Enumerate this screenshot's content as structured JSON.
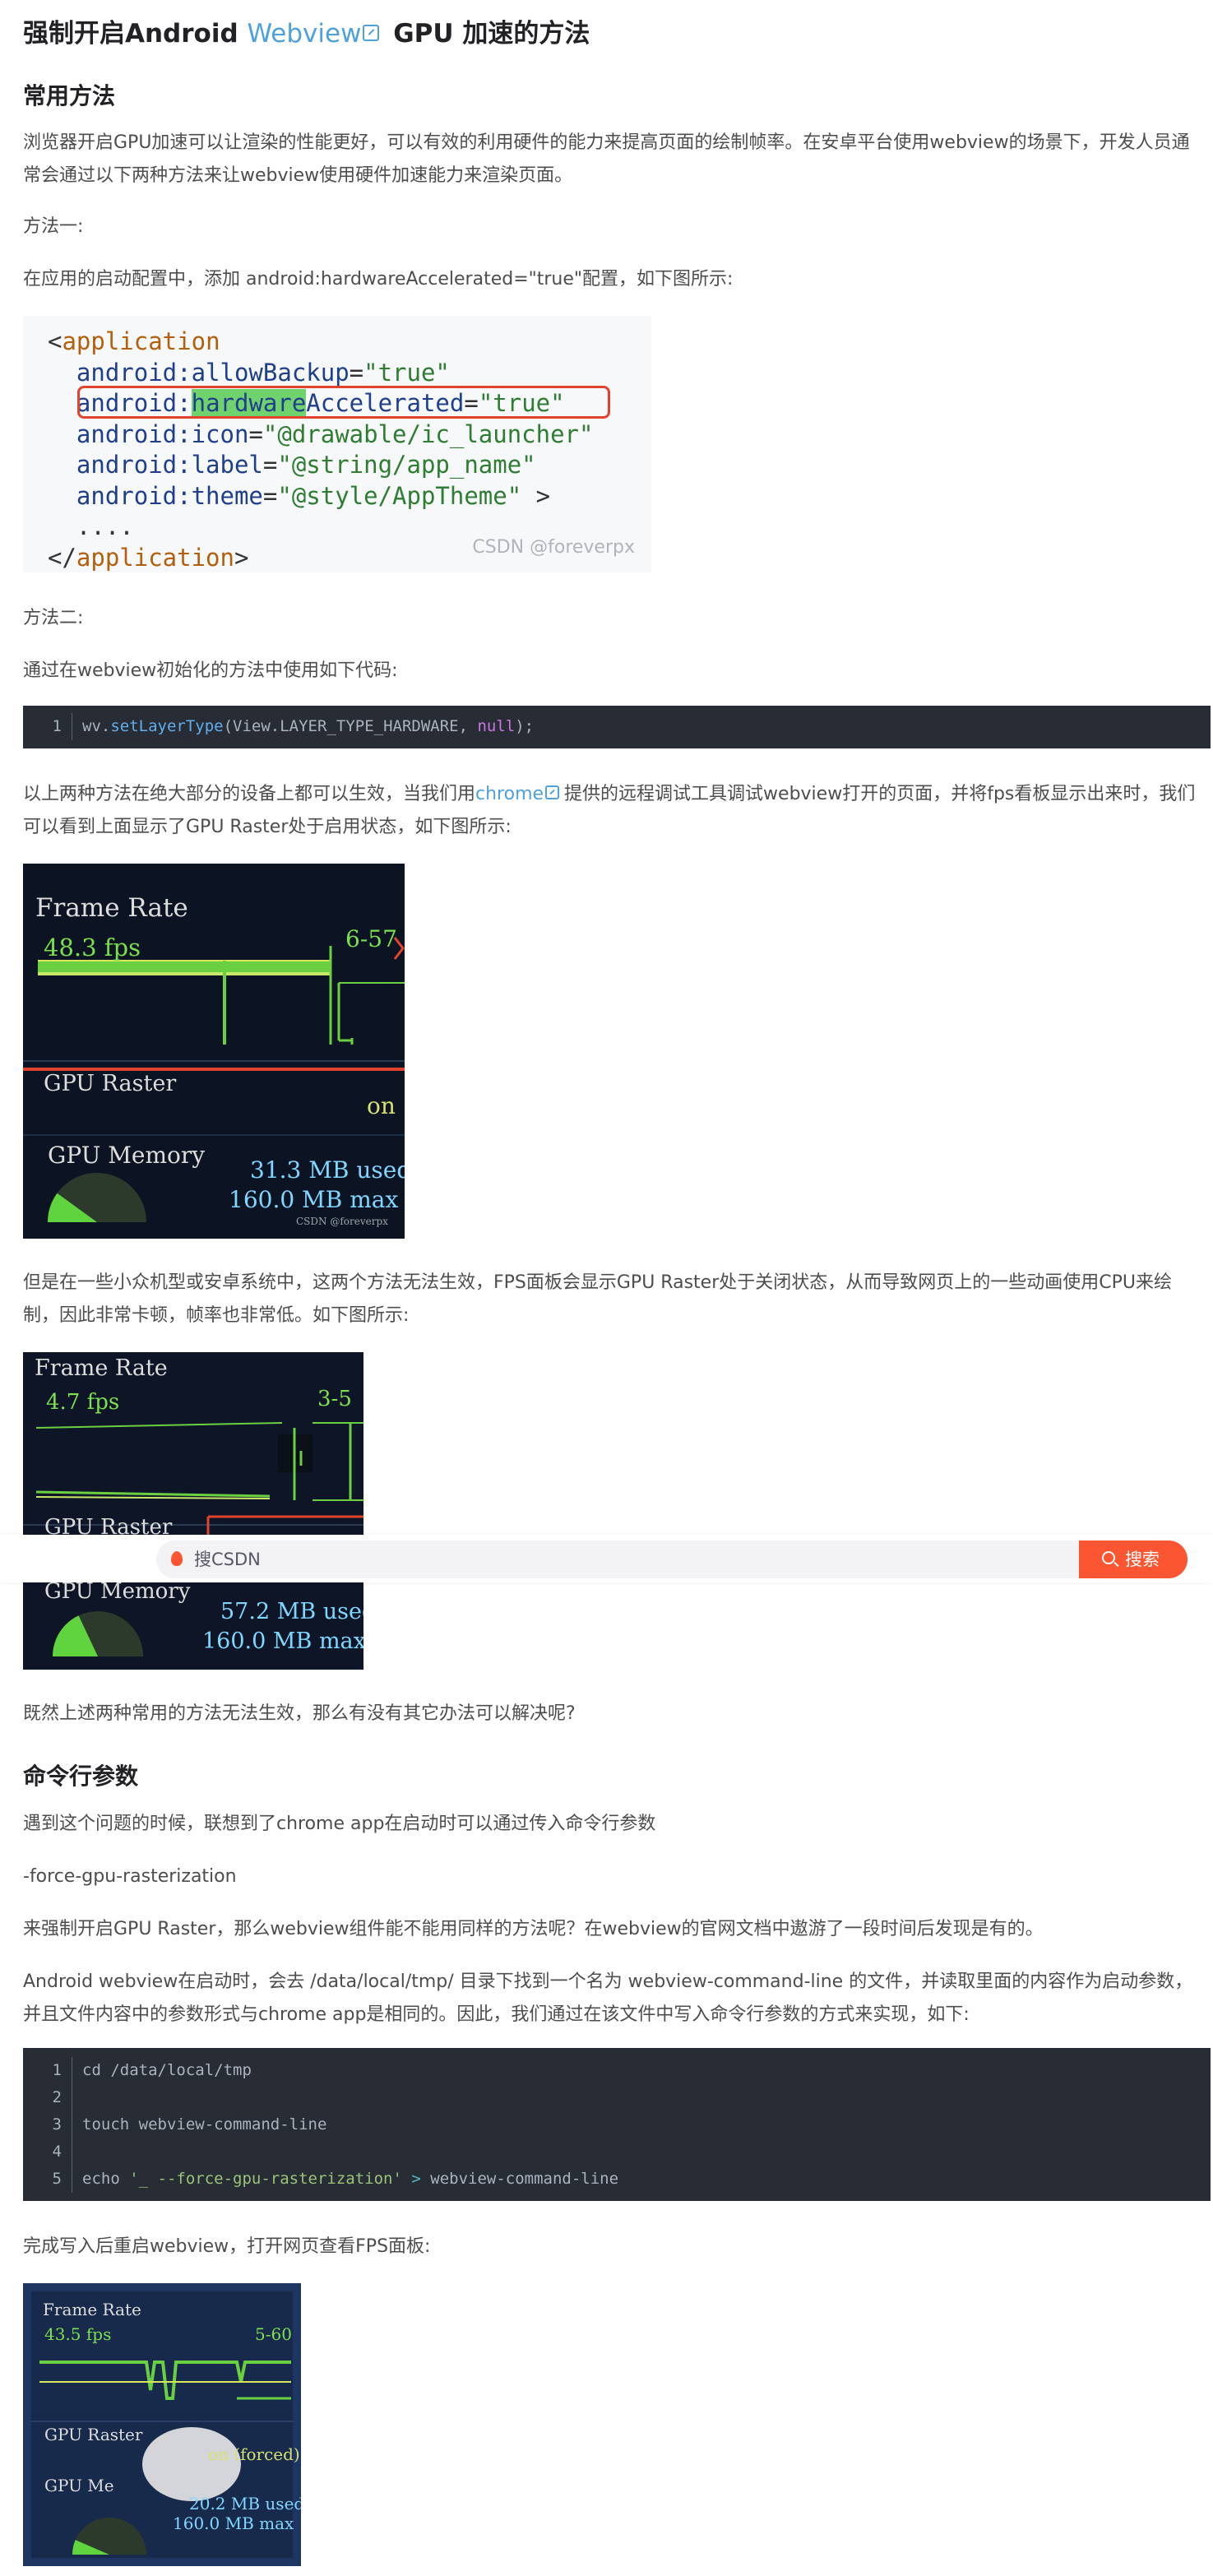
{
  "title": {
    "prefix": "强制开启Android ",
    "link": "Webview",
    "suffix": " GPU 加速的方法"
  },
  "sections": {
    "h1": "常用方法",
    "p1": "浏览器开启GPU加速可以让渲染的性能更好，可以有效的利用硬件的能力来提高页面的绘制帧率。在安卓平台使用webview的场景下，开发人员通常会通过以下两种方法来让webview使用硬件加速能力来渲染页面。",
    "m1": "方法一:",
    "p2": "在应用的启动配置中，添加 android:hardwareAccelerated=\"true\"配置，如下图所示:",
    "m2": "方法二:",
    "p3": "通过在webview初始化的方法中使用如下代码:",
    "p4_a": "以上两种方法在绝大部分的设备上都可以生效，当我们用",
    "p4_link": "chrome",
    "p4_b": "提供的远程调试工具调试webview打开的页面，并将fps看板显示出来时，我们可以看到上面显示了GPU Raster处于启用状态，如下图所示:",
    "p5": "但是在一些小众机型或安卓系统中，这两个方法无法生效，FPS面板会显示GPU Raster处于关闭状态，从而导致网页上的一些动画使用CPU来绘制，因此非常卡顿，帧率也非常低。如下图所示:",
    "p6": "既然上述两种常用的方法无法生效，那么有没有其它办法可以解决呢?",
    "h2": "命令行参数",
    "p7": "遇到这个问题的时候，联想到了chrome app在启动时可以通过传入命令行参数",
    "p8": "-force-gpu-rasterization",
    "p9": "来强制开启GPU Raster，那么webview组件能不能用同样的方法呢？在webview的官网文档中遨游了一段时间后发现是有的。",
    "p10": "Android webview在启动时，会去 /data/local/tmp/ 目录下找到一个名为 webview-command-line 的文件，并读取里面的内容作为启动参数，并且文件内容中的参数形式与chrome app是相同的。因此，我们通过在该文件中写入命令行参数的方式来实现，如下:",
    "p11": "完成写入后重启webview，打开网页查看FPS面板:"
  },
  "xml": {
    "open_lt": "<",
    "open_tag": "application",
    "l2_attr": "android:allowBackup",
    "l2_val": "\"true\"",
    "l3_ns": "android:",
    "l3_hl": "hardware",
    "l3_rest": "Accelerated",
    "l3_val": "\"true\"",
    "l4_attr": "android:icon",
    "l4_val": "\"@drawable/ic_launcher\"",
    "l5_attr": "android:label",
    "l5_val": "\"@string/app_name\"",
    "l6_attr": "android:theme",
    "l6_val": "\"@style/AppTheme\"",
    "l6_end": " >",
    "l7": "....",
    "close_lt": "</",
    "close_tag": "application",
    "close_gt": ">",
    "eq": "=",
    "watermark": "CSDN @foreverpx"
  },
  "code1": {
    "ln": "1",
    "a": "wv.",
    "fn": "setLayerType",
    "b": "(View.LAYER_TYPE_HARDWARE, ",
    "kw": "null",
    "c": ");"
  },
  "code2": {
    "lines": [
      "1",
      "2",
      "3",
      "4",
      "5"
    ],
    "l1": "cd /data/local/tmp",
    "l3": "touch webview-command-line",
    "l5_a": "echo ",
    "l5_str": "'_ --force-gpu-rasterization'",
    "l5_op": " > ",
    "l5_b": "webview-command-line"
  },
  "fps1": {
    "frame_rate": "Frame Rate",
    "fps": "48.3 fps",
    "range": "6-57",
    "gpu_raster": "GPU Raster",
    "raster_status": "on",
    "gpu_memory": "GPU Memory",
    "used": "31.3 MB used",
    "max": "160.0 MB max",
    "watermark": "CSDN @foreverpx",
    "memory_fill": 0.2
  },
  "fps2": {
    "frame_rate": "Frame Rate",
    "fps": "4.7 fps",
    "range": "3-5",
    "gpu_raster": "GPU Raster",
    "gpu_memory": "GPU Memory",
    "used": "57.2 MB used",
    "max": "160.0 MB max",
    "memory_fill": 0.36
  },
  "fps3": {
    "frame_rate": "Frame Rate",
    "fps": "43.5 fps",
    "range": "5-60",
    "gpu_raster": "GPU Raster",
    "raster_status": "on (forced)",
    "gpu_memory": "GPU Me",
    "used": "20.2 MB used",
    "max": "160.0 MB max",
    "memory_fill": 0.13
  },
  "search": {
    "placeholder": "搜CSDN",
    "button": "搜索"
  }
}
